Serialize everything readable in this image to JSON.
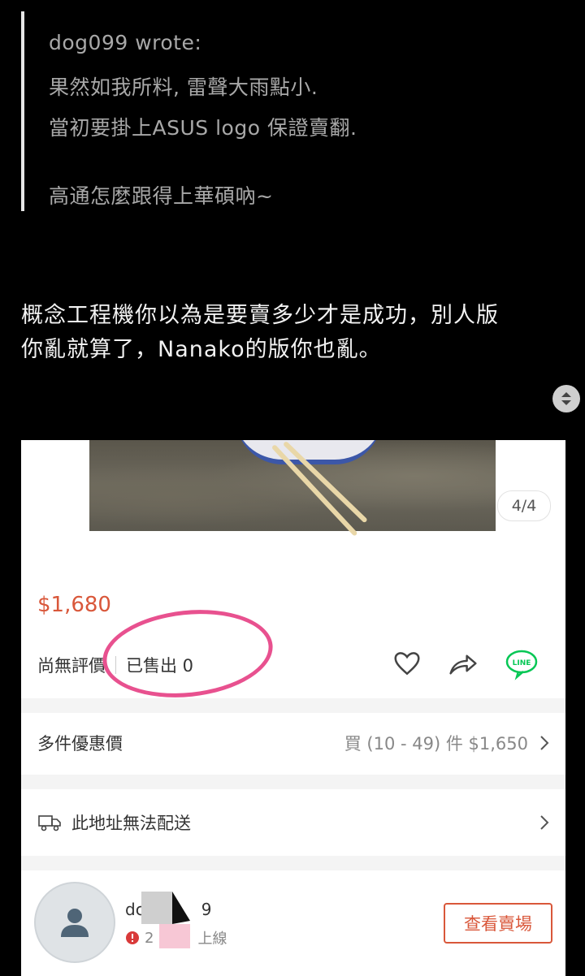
{
  "quote": {
    "author": "dog099 wrote:",
    "lines": [
      "果然如我所料, 雷聲大雨點小.",
      "當初要掛上ASUS logo 保證賣翻.",
      "",
      "高通怎麼跟得上華碩吶~"
    ]
  },
  "post": {
    "line1": "概念工程機你以為是要賣多少才是成功，別人版",
    "line2": "你亂就算了，Nanako的版你也亂。"
  },
  "screenshot": {
    "pager": "4/4",
    "price": "$1,680",
    "rating": "尚無評價",
    "sold": "已售出 0",
    "bulk_label": "多件優惠價",
    "bulk_value": "買 (10 - 49) 件 $1,650",
    "shipping_label": "此地址無法配送",
    "seller_name": "dc",
    "seller_name_tail": "9",
    "seller_status_prefix": "2",
    "seller_status_suffix": "上線",
    "shop_button": "查看賣場",
    "line_icon_text": "LINE"
  },
  "colors": {
    "accent": "#d9573a",
    "annotation": "#e8518f",
    "line_green": "#06c755"
  },
  "icons": [
    "scroll-toggle-icon",
    "heart-icon",
    "share-icon",
    "line-share-icon",
    "chevron-right-icon",
    "truck-icon",
    "user-icon",
    "alert-icon"
  ]
}
